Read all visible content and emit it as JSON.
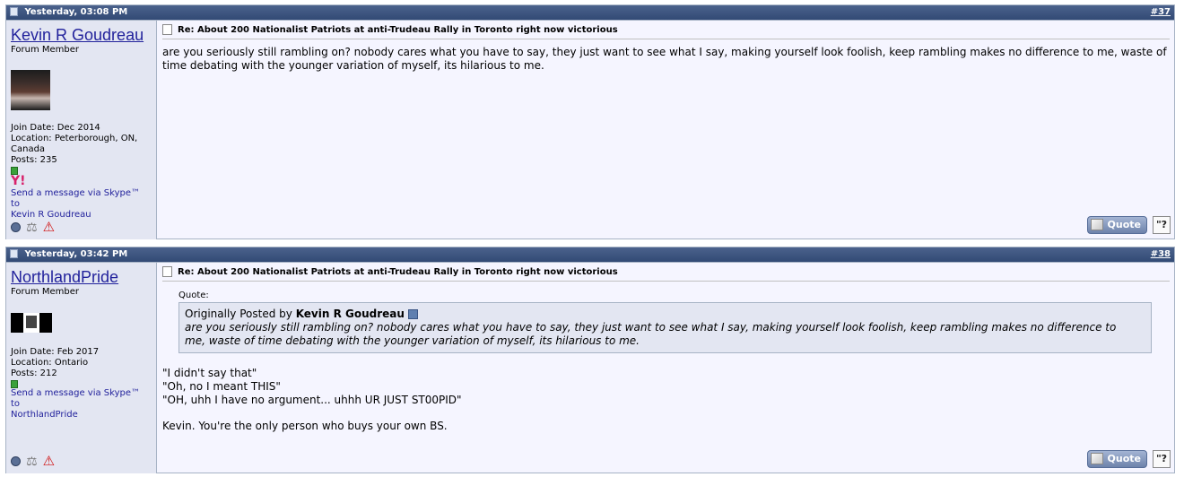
{
  "posts": [
    {
      "date": "Yesterday, 03:08 PM",
      "number": "#37",
      "username": "Kevin R Goudreau",
      "user_title": "Forum Member",
      "join_date": "Join Date: Dec 2014",
      "location_line1": "Location: Peterborough, ON,",
      "location_line2": "Canada",
      "posts_count": "Posts: 235",
      "yahoo_glyph": "Y!",
      "skype_line1": "Send a message via Skype™ to",
      "skype_line2": "Kevin R Goudreau",
      "title": "Re: About 200 Nationalist Patriots at anti-Trudeau Rally in Toronto right now victorious",
      "message": "are you seriously still rambling on? nobody cares what you have to say, they just want to see what I say, making yourself look foolish, keep rambling makes no difference to me, waste of time debating with the younger variation of myself, its hilarious to me.",
      "quote_button": "Quote"
    },
    {
      "date": "Yesterday, 03:42 PM",
      "number": "#38",
      "username": "NorthlandPride",
      "user_title": "Forum Member",
      "join_date": "Join Date: Feb 2017",
      "location": "Location: Ontario",
      "posts_count": "Posts: 212",
      "skype_line1": "Send a message via Skype™ to",
      "skype_line2": "NorthlandPride",
      "title": "Re: About 200 Nationalist Patriots at anti-Trudeau Rally in Toronto right now victorious",
      "quote_label": "Quote:",
      "quote_prefix": "Originally Posted by",
      "quote_author": "Kevin R Goudreau",
      "quote_text": "are you seriously still rambling on? nobody cares what you have to say, they just want to see what I say, making yourself look foolish, keep rambling makes no difference to me, waste of time debating with the younger variation of myself, its hilarious to me.",
      "lines": [
        "\"I didn't say that\"",
        "\"Oh, no I meant THIS\"",
        "\"OH, uhh I have no argument... uhhh UR JUST ST00PID\"",
        "Kevin. You're the only person who buys your own BS."
      ],
      "quote_button": "Quote"
    }
  ],
  "icons": {
    "header": "post-doc-icon",
    "title": "post-title-icon",
    "online": "online-status-icon",
    "reputation": "reputation-scale-icon",
    "report": "report-warning-icon",
    "view_post": "view-post-arrow-icon",
    "multiquote": "multiquote-icon"
  }
}
